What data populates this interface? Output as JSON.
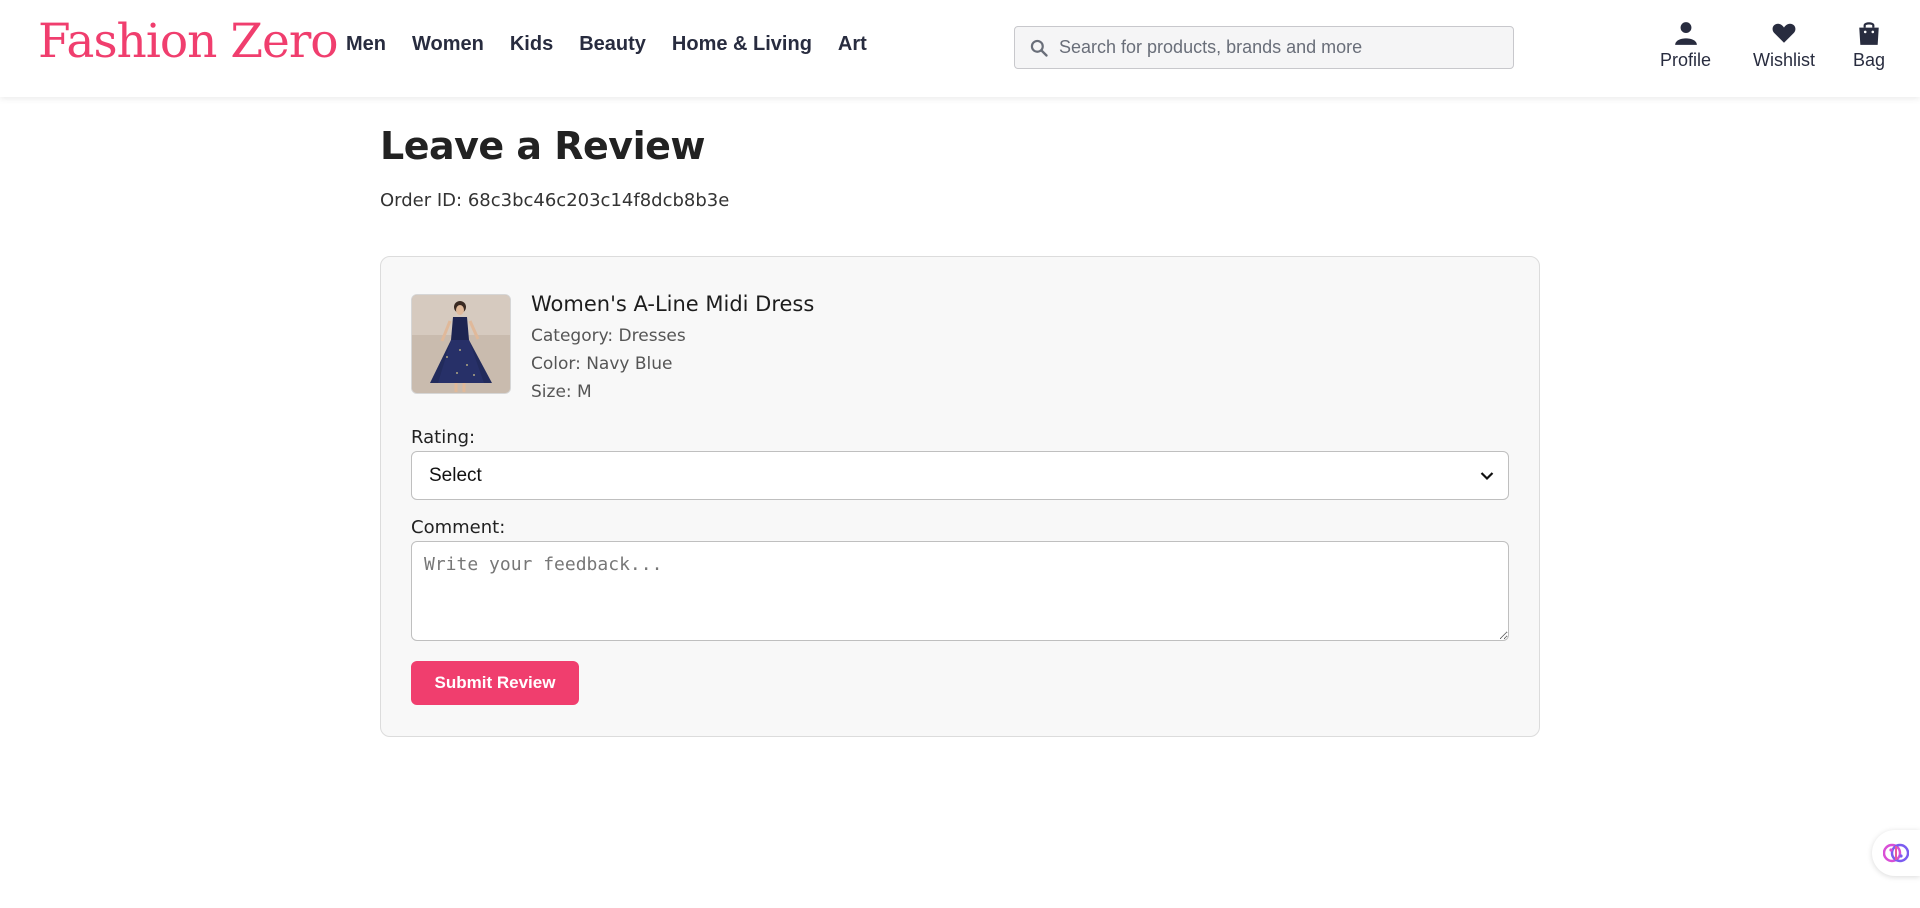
{
  "header": {
    "logo": "Fashion Zero",
    "nav": [
      "Men",
      "Women",
      "Kids",
      "Beauty",
      "Home & Living",
      "Art"
    ],
    "search": {
      "placeholder": "Search for products, brands and more"
    },
    "actions": {
      "profile": "Profile",
      "wishlist": "Wishlist",
      "bag": "Bag"
    }
  },
  "page": {
    "title": "Leave a Review",
    "order_id": "Order ID: 68c3bc46c203c14f8dcb8b3e"
  },
  "product": {
    "name": "Women's A-Line Midi Dress",
    "category": "Category: Dresses",
    "color": "Color: Navy Blue",
    "size": "Size: M"
  },
  "form": {
    "rating_label": "Rating:",
    "rating_value": "Select",
    "comment_label": "Comment:",
    "comment_placeholder": "Write your feedback...",
    "submit_label": "Submit Review"
  },
  "colors": {
    "brand": "#f03e6e",
    "text": "#282c3f",
    "card_bg": "#f8f8f8"
  },
  "icons": [
    "search-icon",
    "profile-icon",
    "heart-icon",
    "bag-icon",
    "chevron-down-icon",
    "assistant-brain-icon"
  ]
}
